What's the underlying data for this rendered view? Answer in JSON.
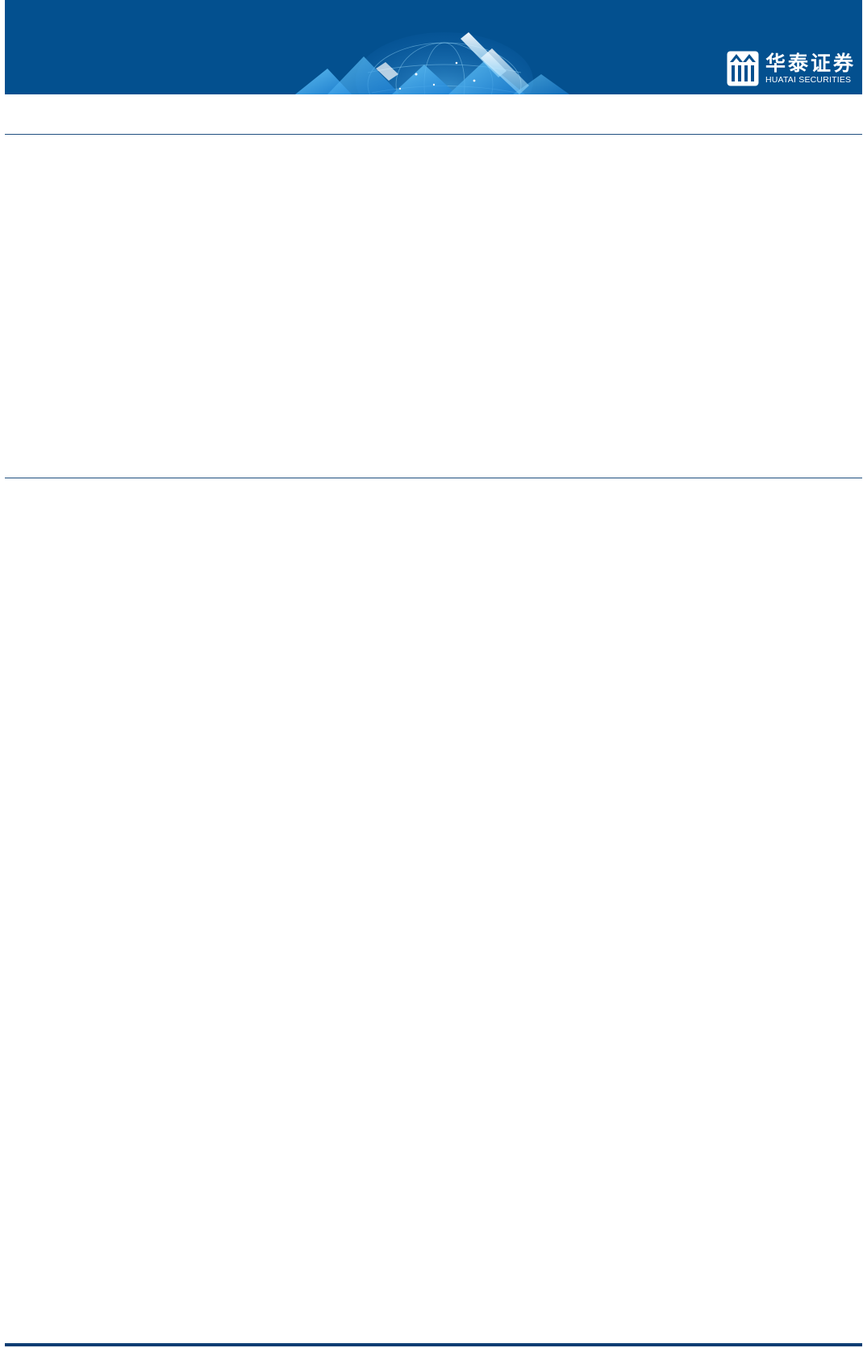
{
  "header": {
    "logo": {
      "name_cn": "华泰证券",
      "name_en": "HUATAI SECURITIES",
      "icon": "huatai-logo-icon"
    },
    "banner_art_icon": "globe-arrows-graphic"
  },
  "colors": {
    "banner": "#03508f",
    "rule": "#1f4f7f",
    "footer_bar": "#0c3d73",
    "background": "#ffffff"
  }
}
